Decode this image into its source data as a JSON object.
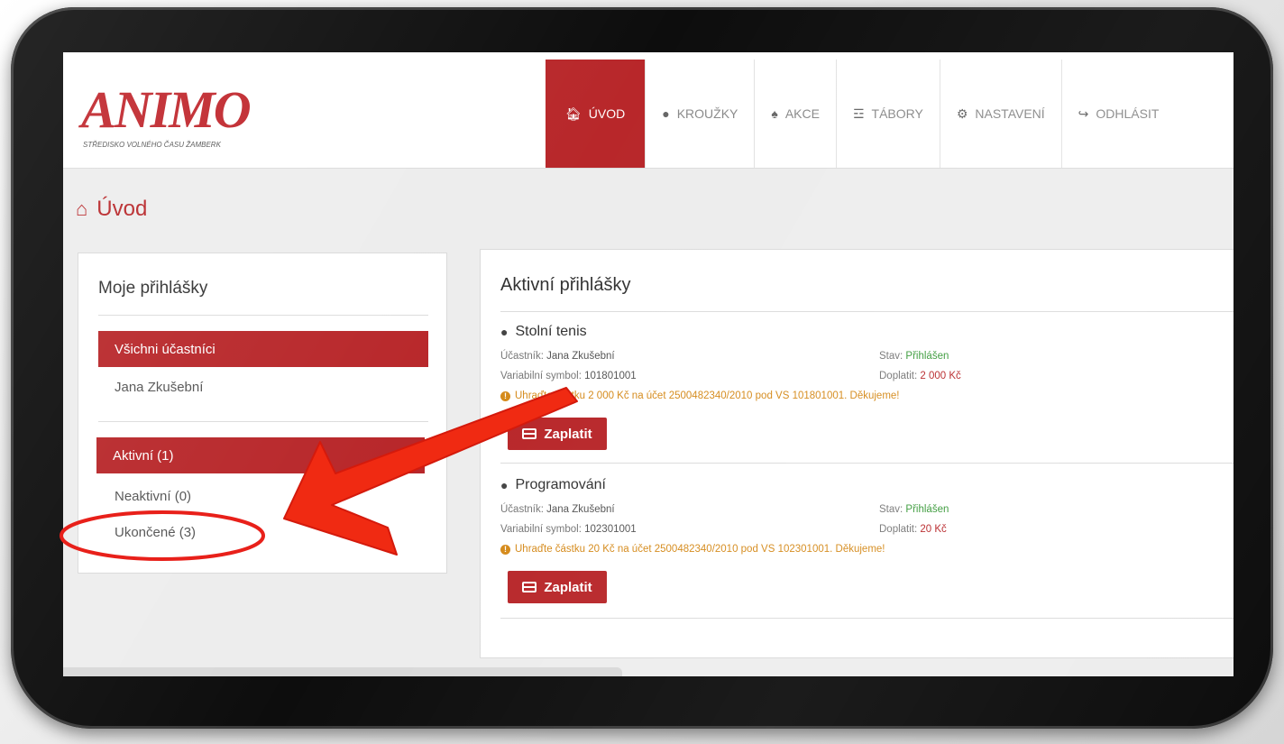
{
  "brand": {
    "logo_text": "ANIMO",
    "logo_subtitle": "STŘEDISKO VOLNÉHO ČASU ŽAMBERK"
  },
  "nav": [
    {
      "label": "ÚVOD",
      "icon": "home-icon",
      "active": true
    },
    {
      "label": "KROUŽKY",
      "icon": "lightbulb-icon",
      "active": false
    },
    {
      "label": "AKCE",
      "icon": "trophy-icon",
      "active": false
    },
    {
      "label": "TÁBORY",
      "icon": "signpost-icon",
      "active": false
    },
    {
      "label": "NASTAVENÍ",
      "icon": "gear-icon",
      "active": false
    },
    {
      "label": "ODHLÁSIT",
      "icon": "logout-icon",
      "active": false
    }
  ],
  "page": {
    "title": "Úvod"
  },
  "sidebar": {
    "title": "Moje přihlášky",
    "participants_header": "Všichni účastníci",
    "participant": "Jana Zkušební",
    "filters": [
      {
        "label": "Aktivní (1)",
        "active": true
      },
      {
        "label": "Neaktivní (0)",
        "active": false
      },
      {
        "label": "Ukončené (3)",
        "active": false
      }
    ]
  },
  "main": {
    "title": "Aktivní přihlášky",
    "entries": [
      {
        "name": "Stolní tenis",
        "participant_label": "Účastník:",
        "participant": "Jana Zkušební",
        "vs_label": "Variabilní symbol:",
        "vs": "101801001",
        "status_label": "Stav:",
        "status": "Přihlášen",
        "due_label": "Doplatit:",
        "due": "2 000 Kč",
        "notice": "Uhraďte částku 2 000 Kč na účet 2500482340/2010 pod VS 101801001. Děkujeme!",
        "button": "Zaplatit"
      },
      {
        "name": "Programování",
        "participant_label": "Účastník:",
        "participant": "Jana Zkušební",
        "vs_label": "Variabilní symbol:",
        "vs": "102301001",
        "status_label": "Stav:",
        "status": "Přihlášen",
        "due_label": "Doplatit:",
        "due": "20 Kč",
        "notice": "Uhraďte částku 20 Kč na účet 2500482340/2010 pod VS 102301001. Děkujeme!",
        "button": "Zaplatit"
      }
    ]
  },
  "colors": {
    "accent": "#b8272a",
    "status_ok": "#3a9a3a",
    "warning": "#d58a1a",
    "annotation": "#f02a12"
  }
}
